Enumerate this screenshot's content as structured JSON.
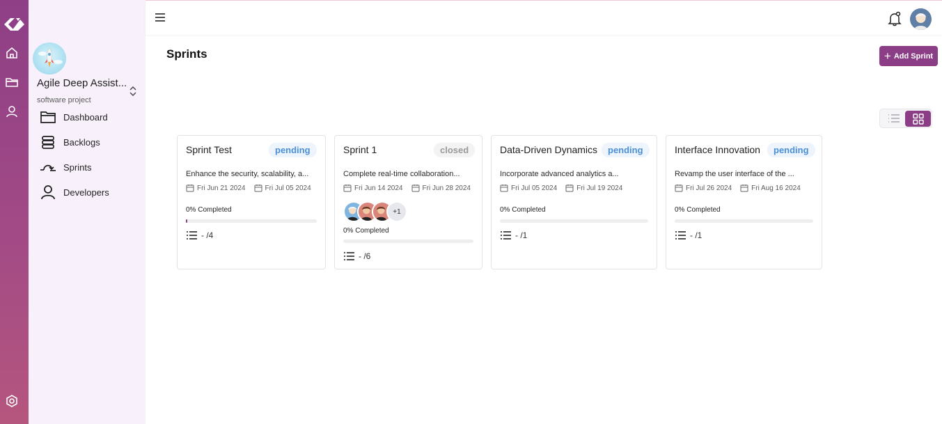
{
  "project": {
    "name": "Agile Deep Assist...",
    "type": "software project"
  },
  "sidebar": {
    "items": [
      {
        "label": "Dashboard",
        "icon": "folder-icon"
      },
      {
        "label": "Backlogs",
        "icon": "stack-icon"
      },
      {
        "label": "Sprints",
        "icon": "sprint-arrow-icon"
      },
      {
        "label": "Developers",
        "icon": "person-icon"
      }
    ]
  },
  "rail": {
    "icons": [
      "logo-icon",
      "home-icon",
      "folder-icon",
      "user-icon",
      "settings-icon"
    ]
  },
  "header": {
    "menu_icon": "hamburger-icon",
    "notification_icon": "bell-icon"
  },
  "page": {
    "title": "Sprints",
    "add_button": "Add Sprint",
    "view_toggle": {
      "options": [
        "list-view",
        "grid-view"
      ],
      "selected": "grid-view"
    }
  },
  "sprints": [
    {
      "title": "Sprint Test",
      "status": "pending",
      "description": "Enhance the security, scalability, a...",
      "start": "Fri Jun 21 2024",
      "end": "Fri Jul 05 2024",
      "progress_label": "0% Completed",
      "progress": 0.01,
      "tasks": "- /4"
    },
    {
      "title": "Sprint 1",
      "status": "closed",
      "description": "Complete real-time collaboration...",
      "start": "Fri Jun 14 2024",
      "end": "Fri Jun 28 2024",
      "avatars_more": "+1",
      "progress_label": "0% Completed",
      "progress": 0,
      "tasks": "- /6"
    },
    {
      "title": "Data-Driven Dynamics",
      "status": "pending",
      "description": "Incorporate advanced analytics a...",
      "start": "Fri Jul 05 2024",
      "end": "Fri Jul 19 2024",
      "progress_label": "0% Completed",
      "progress": 0,
      "tasks": "- /1"
    },
    {
      "title": "Interface Innovation",
      "status": "pending",
      "description": "Revamp the user interface of the ...",
      "start": "Fri Jul 26 2024",
      "end": "Fri Aug 16 2024",
      "progress_label": "0% Completed",
      "progress": 0,
      "tasks": "- /1"
    }
  ],
  "colors": {
    "accent": "#8b3e86",
    "pending_text": "#4a90d9",
    "closed_text": "#9a9a9a",
    "sidebar_bg": "#f8f1fc"
  }
}
